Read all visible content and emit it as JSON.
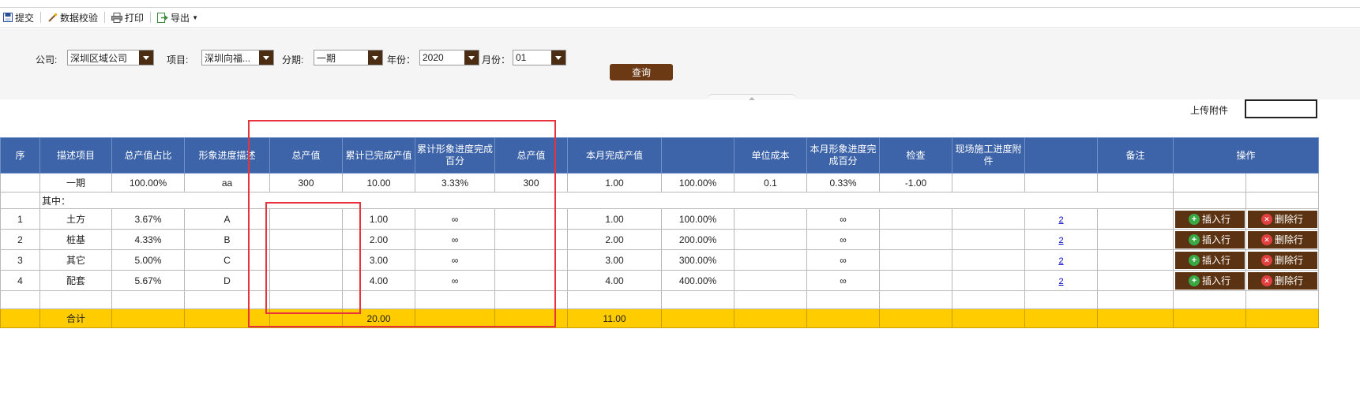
{
  "toolbar": {
    "submit": "提交",
    "validate": "数据校验",
    "print": "打印",
    "export": "导出"
  },
  "filters": {
    "company_label": "公司:",
    "company_value": "深圳区域公司",
    "project_label": "项目:",
    "project_value": "深圳向福...",
    "period_label": "分期:",
    "period_value": "一期",
    "year_label": "年份：",
    "year_value": "2020",
    "month_label": "月份：",
    "month_value": "01",
    "query_button": "查询"
  },
  "upload": {
    "label": "上传附件"
  },
  "table": {
    "headers": [
      "序",
      "描述项目",
      "总产值占比",
      "形象进度描述",
      "总产值",
      "累计已完成产值",
      "累计形象进度完成百分",
      "总产值",
      "本月完成产值",
      "",
      "单位成本",
      "本月形象进度完成百分",
      "检查",
      "现场施工进度附件",
      "",
      "备注",
      "操作"
    ],
    "summary_row": [
      "",
      "一期",
      "100.00%",
      "aa",
      "300",
      "10.00",
      "3.33%",
      "300",
      "1.00",
      "100.00%",
      "0.1",
      "0.33%",
      "-1.00",
      "",
      "",
      "",
      "",
      ""
    ],
    "sub_label": "其中：",
    "rows": [
      {
        "no": "1",
        "item": "土方",
        "ratio": "3.67%",
        "desc": "A",
        "total": "",
        "cum_done": "1.00",
        "cum_pct": "∞",
        "total2": "",
        "month_done": "1.00",
        "pct": "100.00%",
        "unit_cost": "",
        "month_pct": "∞",
        "check": "",
        "attach": "",
        "link": "2",
        "remark": ""
      },
      {
        "no": "2",
        "item": "桩基",
        "ratio": "4.33%",
        "desc": "B",
        "total": "",
        "cum_done": "2.00",
        "cum_pct": "∞",
        "total2": "",
        "month_done": "2.00",
        "pct": "200.00%",
        "unit_cost": "",
        "month_pct": "∞",
        "check": "",
        "attach": "",
        "link": "2",
        "remark": ""
      },
      {
        "no": "3",
        "item": "其它",
        "ratio": "5.00%",
        "desc": "C",
        "total": "",
        "cum_done": "3.00",
        "cum_pct": "∞",
        "total2": "",
        "month_done": "3.00",
        "pct": "300.00%",
        "unit_cost": "",
        "month_pct": "∞",
        "check": "",
        "attach": "",
        "link": "2",
        "remark": ""
      },
      {
        "no": "4",
        "item": "配套",
        "ratio": "5.67%",
        "desc": "D",
        "total": "",
        "cum_done": "4.00",
        "cum_pct": "∞",
        "total2": "",
        "month_done": "4.00",
        "pct": "400.00%",
        "unit_cost": "",
        "month_pct": "∞",
        "check": "",
        "attach": "",
        "link": "2",
        "remark": ""
      }
    ],
    "insert_label": "插入行",
    "delete_label": "删除行",
    "total_label": "合计",
    "total_cum_done": "20.00",
    "total_month_done": "11.00"
  },
  "colors": {
    "header_bg": "#3d64a9",
    "total_bg": "#ffcc00",
    "action_bg": "#5c3312",
    "annotation": "#e8323c"
  },
  "icons": [
    "save-icon",
    "validate-icon",
    "print-icon",
    "export-icon",
    "plus-icon",
    "delete-icon"
  ]
}
